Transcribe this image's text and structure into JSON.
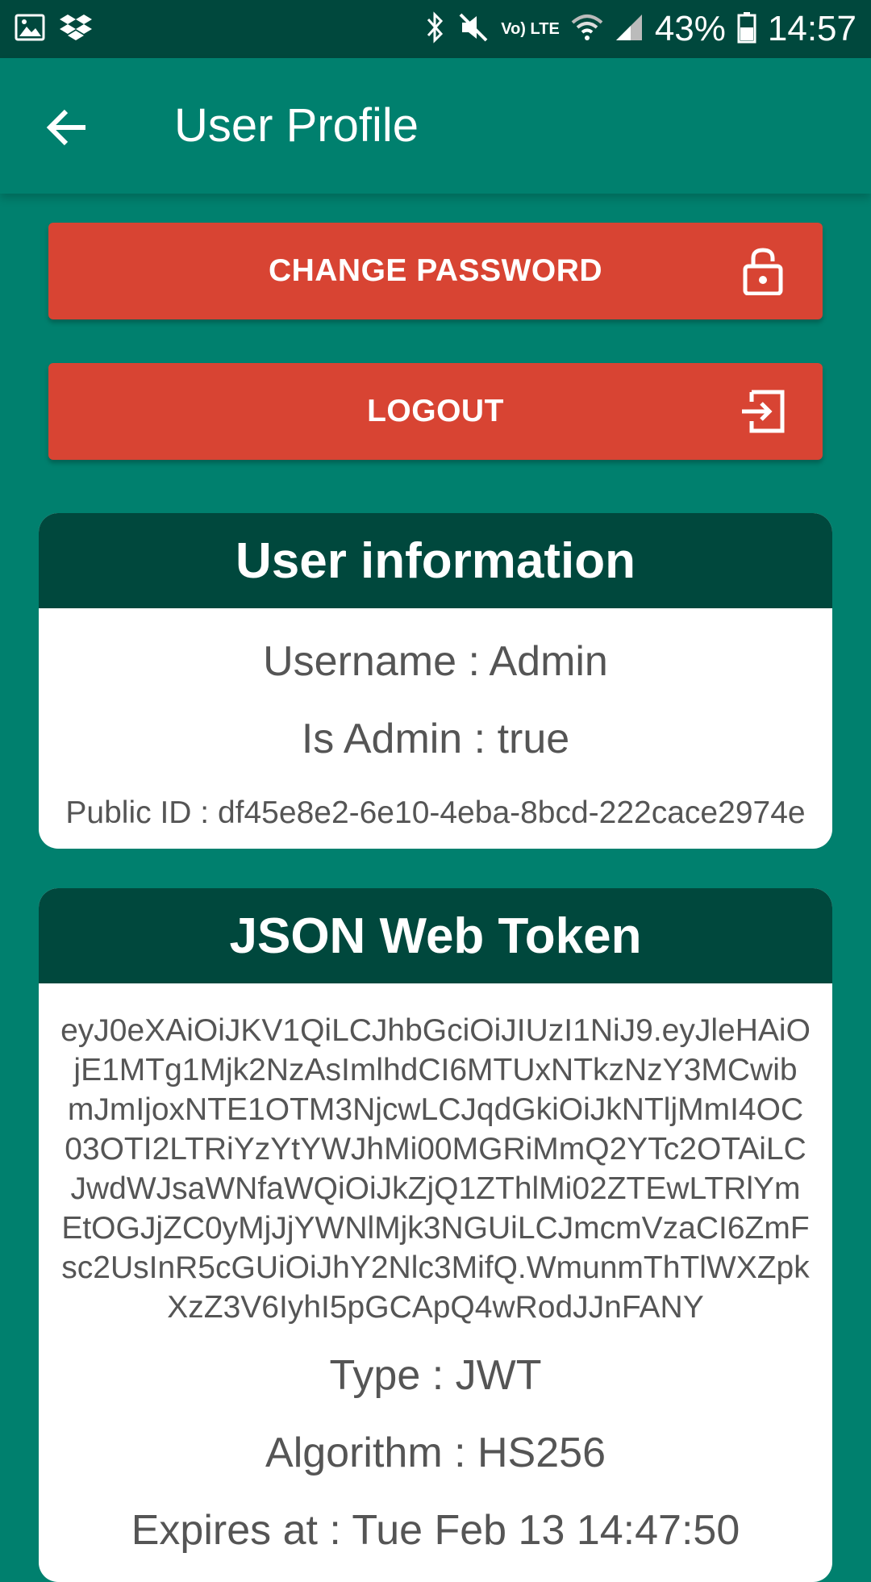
{
  "status_bar": {
    "battery": "43%",
    "time": "14:57",
    "network_label": "Vo) LTE"
  },
  "app_bar": {
    "title": "User Profile",
    "back_icon": "arrow-left-icon"
  },
  "buttons": {
    "change_password": {
      "label": "CHANGE PASSWORD",
      "icon": "lock-open-icon"
    },
    "logout": {
      "label": "LOGOUT",
      "icon": "logout-icon"
    }
  },
  "user_info": {
    "title": "User information",
    "username": "Username : Admin",
    "is_admin": "Is Admin : true",
    "public_id": "Public ID : df45e8e2-6e10-4eba-8bcd-222cace2974e"
  },
  "jwt": {
    "title": "JSON Web Token",
    "token_lines": [
      "eyJ0eXAiOiJKV1QiLCJhbGciOiJIUzI1NiJ9.eyJleHAiO",
      "jE1MTg1Mjk2NzAsImlhdCI6MTUxNTkzNzY3MCwib",
      "mJmIjoxNTE1OTM3NjcwLCJqdGkiOiJkNTljMmI4OC",
      "03OTI2LTRiYzYtYWJhMi00MGRiMmQ2YTc2OTAiLC",
      "JwdWJsaWNfaWQiOiJkZjQ1ZThlMi02ZTEwLTRlYm",
      "EtOGJjZC0yMjJjYWNlMjk3NGUiLCJmcmVzaCI6ZmF",
      "sc2UsInR5cGUiOiJhY2Nlc3MifQ.WmunmThTlWXZpk",
      "XzZ3V6IyhI5pGCApQ4wRodJJnFANY"
    ],
    "type": "Type : JWT",
    "algorithm": "Algorithm : HS256",
    "expires": "Expires at : Tue Feb 13 14:47:50"
  }
}
